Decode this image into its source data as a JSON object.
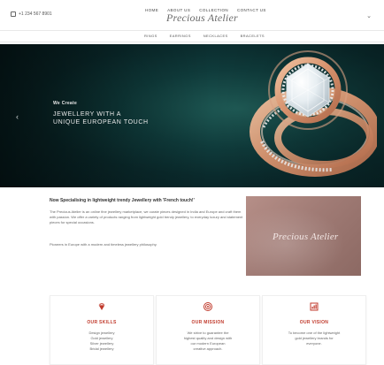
{
  "top_nav": {
    "items": [
      "HOME",
      "ABOUT US",
      "COLLECTION",
      "CONTACT US"
    ]
  },
  "header": {
    "phone": "+1 234 567 8901",
    "brand": "Precious Atelier",
    "toggle_glyph": "⌄"
  },
  "sub_nav": {
    "items": [
      "RINGS",
      "EARRINGS",
      "NECKLACES",
      "BRACELETS"
    ]
  },
  "hero": {
    "kicker": "We Create",
    "title": "JEWELLERY WITH A\nUNIQUE EUROPEAN TOUCH",
    "arrow_left": "‹"
  },
  "about": {
    "heading": "Now Specialising in lightweight trendy Jewellery with 'French touch!'",
    "paragraph_1": "The Precious Atelier is an online fine jewellery marketplace, we curate pieces designed in India and Europe and craft them with passion. We offer a variety of products ranging from lightweight gold trendy jewellery, to everyday luxury and statement pieces for special occasions.",
    "paragraph_2": "Pioneers in Europe with a modern and timeless jewellery philosophy.",
    "image_logo": "Precious Atelier"
  },
  "cards": [
    {
      "title": "OUR SKILLS",
      "text": "Design jewellery\nGold jewellery\nSilver jewellery\nBridal jewellery",
      "icon": "diamond-icon"
    },
    {
      "title": "OUR MISSION",
      "text": "We strive to guarantee the\nhighest quality and design with\nour modern European\ncreative approach.",
      "icon": "target-icon"
    },
    {
      "title": "OUR VISION",
      "text": "To become one of the lightweight\ngold jewellery brands for\neveryone.",
      "icon": "chart-icon"
    }
  ],
  "colors": {
    "accent": "#c0392b",
    "hero_dark": "#0a2a2c",
    "image_tone": "#a07b75"
  }
}
